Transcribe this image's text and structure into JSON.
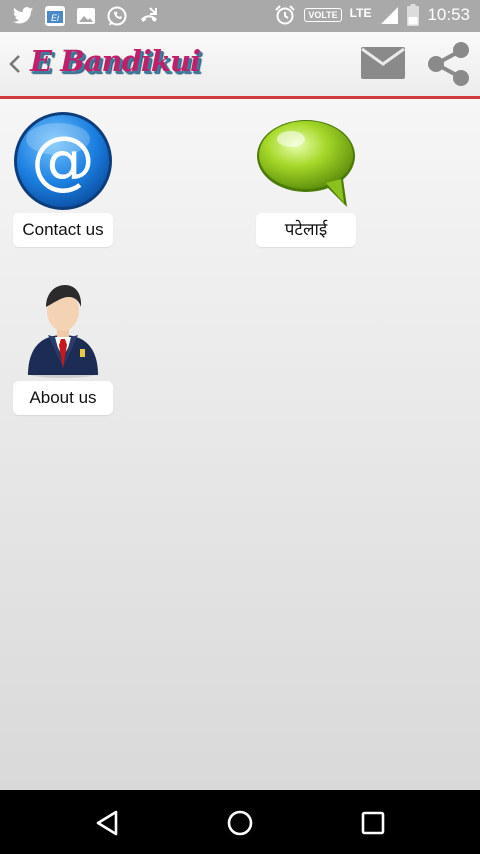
{
  "status_bar": {
    "time": "10:53",
    "volte": "VOLTE",
    "network": "LTE",
    "icons": [
      "twitter-icon",
      "app-notification-icon",
      "image-icon",
      "whatsapp-icon",
      "missed-call-icon",
      "alarm-icon",
      "signal-icon",
      "battery-icon"
    ]
  },
  "app_bar": {
    "title": "E Bandikui",
    "actions": [
      "mail-icon",
      "share-icon"
    ]
  },
  "tiles": [
    {
      "label": "Contact us",
      "icon": "at-sign-icon"
    },
    {
      "label": "पटेलाई",
      "icon": "chat-bubble-icon"
    },
    {
      "label": "About us",
      "icon": "businessman-icon"
    }
  ],
  "nav_bar": [
    "back-triangle-icon",
    "home-circle-icon",
    "recents-square-icon"
  ]
}
